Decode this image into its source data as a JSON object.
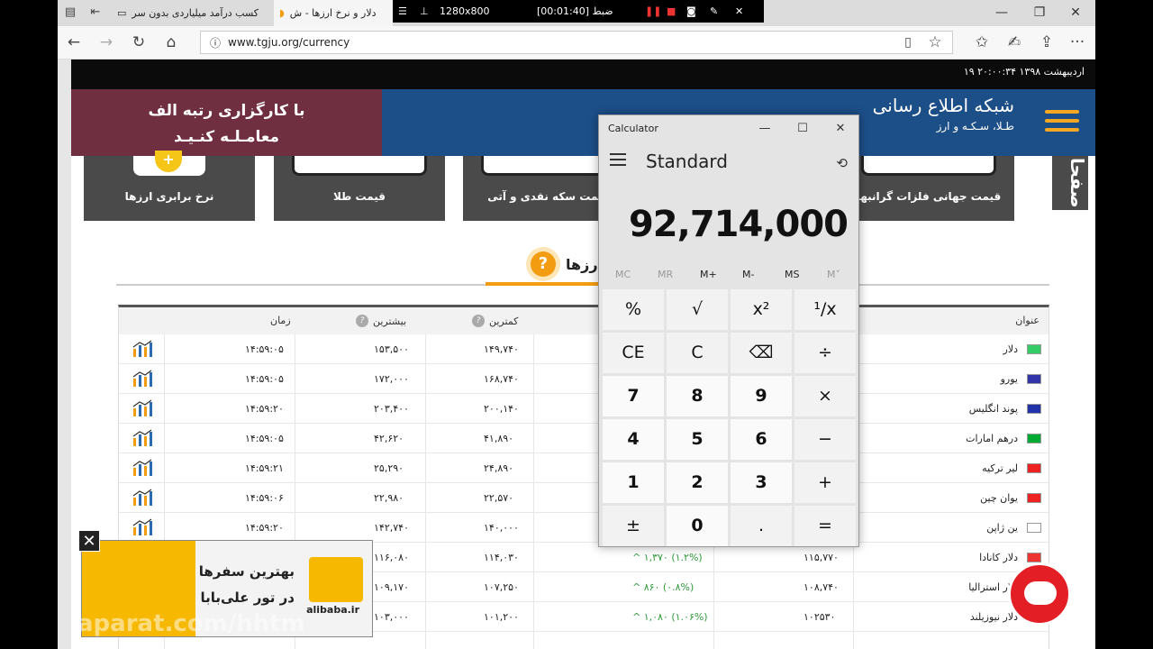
{
  "tabs": [
    {
      "label": "کسب درآمد میلیاردی بدون سر"
    },
    {
      "label": "دلار و نرخ ارزها - ش"
    }
  ],
  "recorder": {
    "resolution": "1280x800",
    "status": "[00:01:40] ضبط"
  },
  "address": {
    "url": "www.tgju.org/currency"
  },
  "date_line": "۱۹ اردیبهشت ۱۳۹۸ ۲۰:۰۰:۳۴",
  "header": {
    "ad_line1": "با کارگزاری رتبه الف",
    "ad_line2": "معامـلـه کنـیـد",
    "brand_title": "شبکه اطلاع رسانی",
    "brand_sub": "طـلا، سـکـه و ارز"
  },
  "shortcuts": [
    "نرخ برابری ارزها",
    "قیمت طلا",
    "قیمت سکه نقدی و آتی",
    "قیمت جهانی فلزات گرانبها"
  ],
  "shortcut_side": "صفحا",
  "section_title": "ارزها",
  "table": {
    "headers": {
      "title": "عنوان",
      "low": "کمترین",
      "high": "بیشترین",
      "time": "زمان"
    },
    "rows": [
      {
        "name": "دلار",
        "low": "۱۴۹,۷۴۰",
        "high": "۱۵۳,۵۰۰",
        "time": "۱۴:۵۹:۰۵",
        "change": "",
        "price": ""
      },
      {
        "name": "یورو",
        "low": "۱۶۸,۷۴۰",
        "high": "۱۷۲,۰۰۰",
        "time": "۱۴:۵۹:۰۵",
        "change": "",
        "price": ""
      },
      {
        "name": "پوند انگلیس",
        "low": "۲۰۰,۱۴۰",
        "high": "۲۰۳,۴۰۰",
        "time": "۱۴:۵۹:۲۰",
        "change": "",
        "price": ""
      },
      {
        "name": "درهم امارات",
        "low": "۴۱,۸۹۰",
        "high": "۴۲,۶۲۰",
        "time": "۱۴:۵۹:۰۵",
        "change": "",
        "price": ""
      },
      {
        "name": "لیر ترکیه",
        "low": "۲۴,۸۹۰",
        "high": "۲۵,۲۹۰",
        "time": "۱۴:۵۹:۲۱",
        "change": "",
        "price": ""
      },
      {
        "name": "یوان چین",
        "low": "۲۲,۵۷۰",
        "high": "۲۲,۹۸۰",
        "time": "۱۴:۵۹:۰۶",
        "change": "",
        "price": ""
      },
      {
        "name": "ین ژاپن",
        "low": "۱۴۰,۰۰۰",
        "high": "۱۴۲,۷۴۰",
        "time": "۱۴:۵۹:۲۰",
        "change": "",
        "price": ""
      },
      {
        "name": "دلار کانادا",
        "low": "۱۱۴,۰۳۰",
        "high": "۱۱۶,۰۸۰",
        "time": "",
        "change": "۱,۳۷۰ (۱.۲%)",
        "price": "۱۱۵,۷۷۰"
      },
      {
        "name": "دلار استرالیا",
        "low": "۱۰۷,۲۵۰",
        "high": "۱۰۹,۱۷۰",
        "time": "",
        "change": "۸۶۰ (۰.۸%)",
        "price": "۱۰۸,۷۴۰"
      },
      {
        "name": "دلار نیوزیلند",
        "low": "۱۰۱,۲۰۰",
        "high": "۱۰۳,۰۰۰",
        "time": "",
        "change": "۱,۰۸۰ (۱.۰۶%)",
        "price": "۱۰۲۵۳۰"
      }
    ]
  },
  "calculator": {
    "title": "Calculator",
    "mode": "Standard",
    "display": "92,714,000",
    "memory": [
      "MC",
      "MR",
      "M+",
      "M-",
      "MS",
      "M˅"
    ],
    "keys": [
      "%",
      "√",
      "x²",
      "¹/x",
      "CE",
      "C",
      "⌫",
      "÷",
      "7",
      "8",
      "9",
      "×",
      "4",
      "5",
      "6",
      "−",
      "1",
      "2",
      "3",
      "+",
      "±",
      "0",
      ".",
      "="
    ]
  },
  "popup_ad": {
    "line1": "بهترین سفرها",
    "line2": "در تور علی‌بابا",
    "site": "alibaba.ir"
  },
  "watermark": "aparat.com/hhtm"
}
